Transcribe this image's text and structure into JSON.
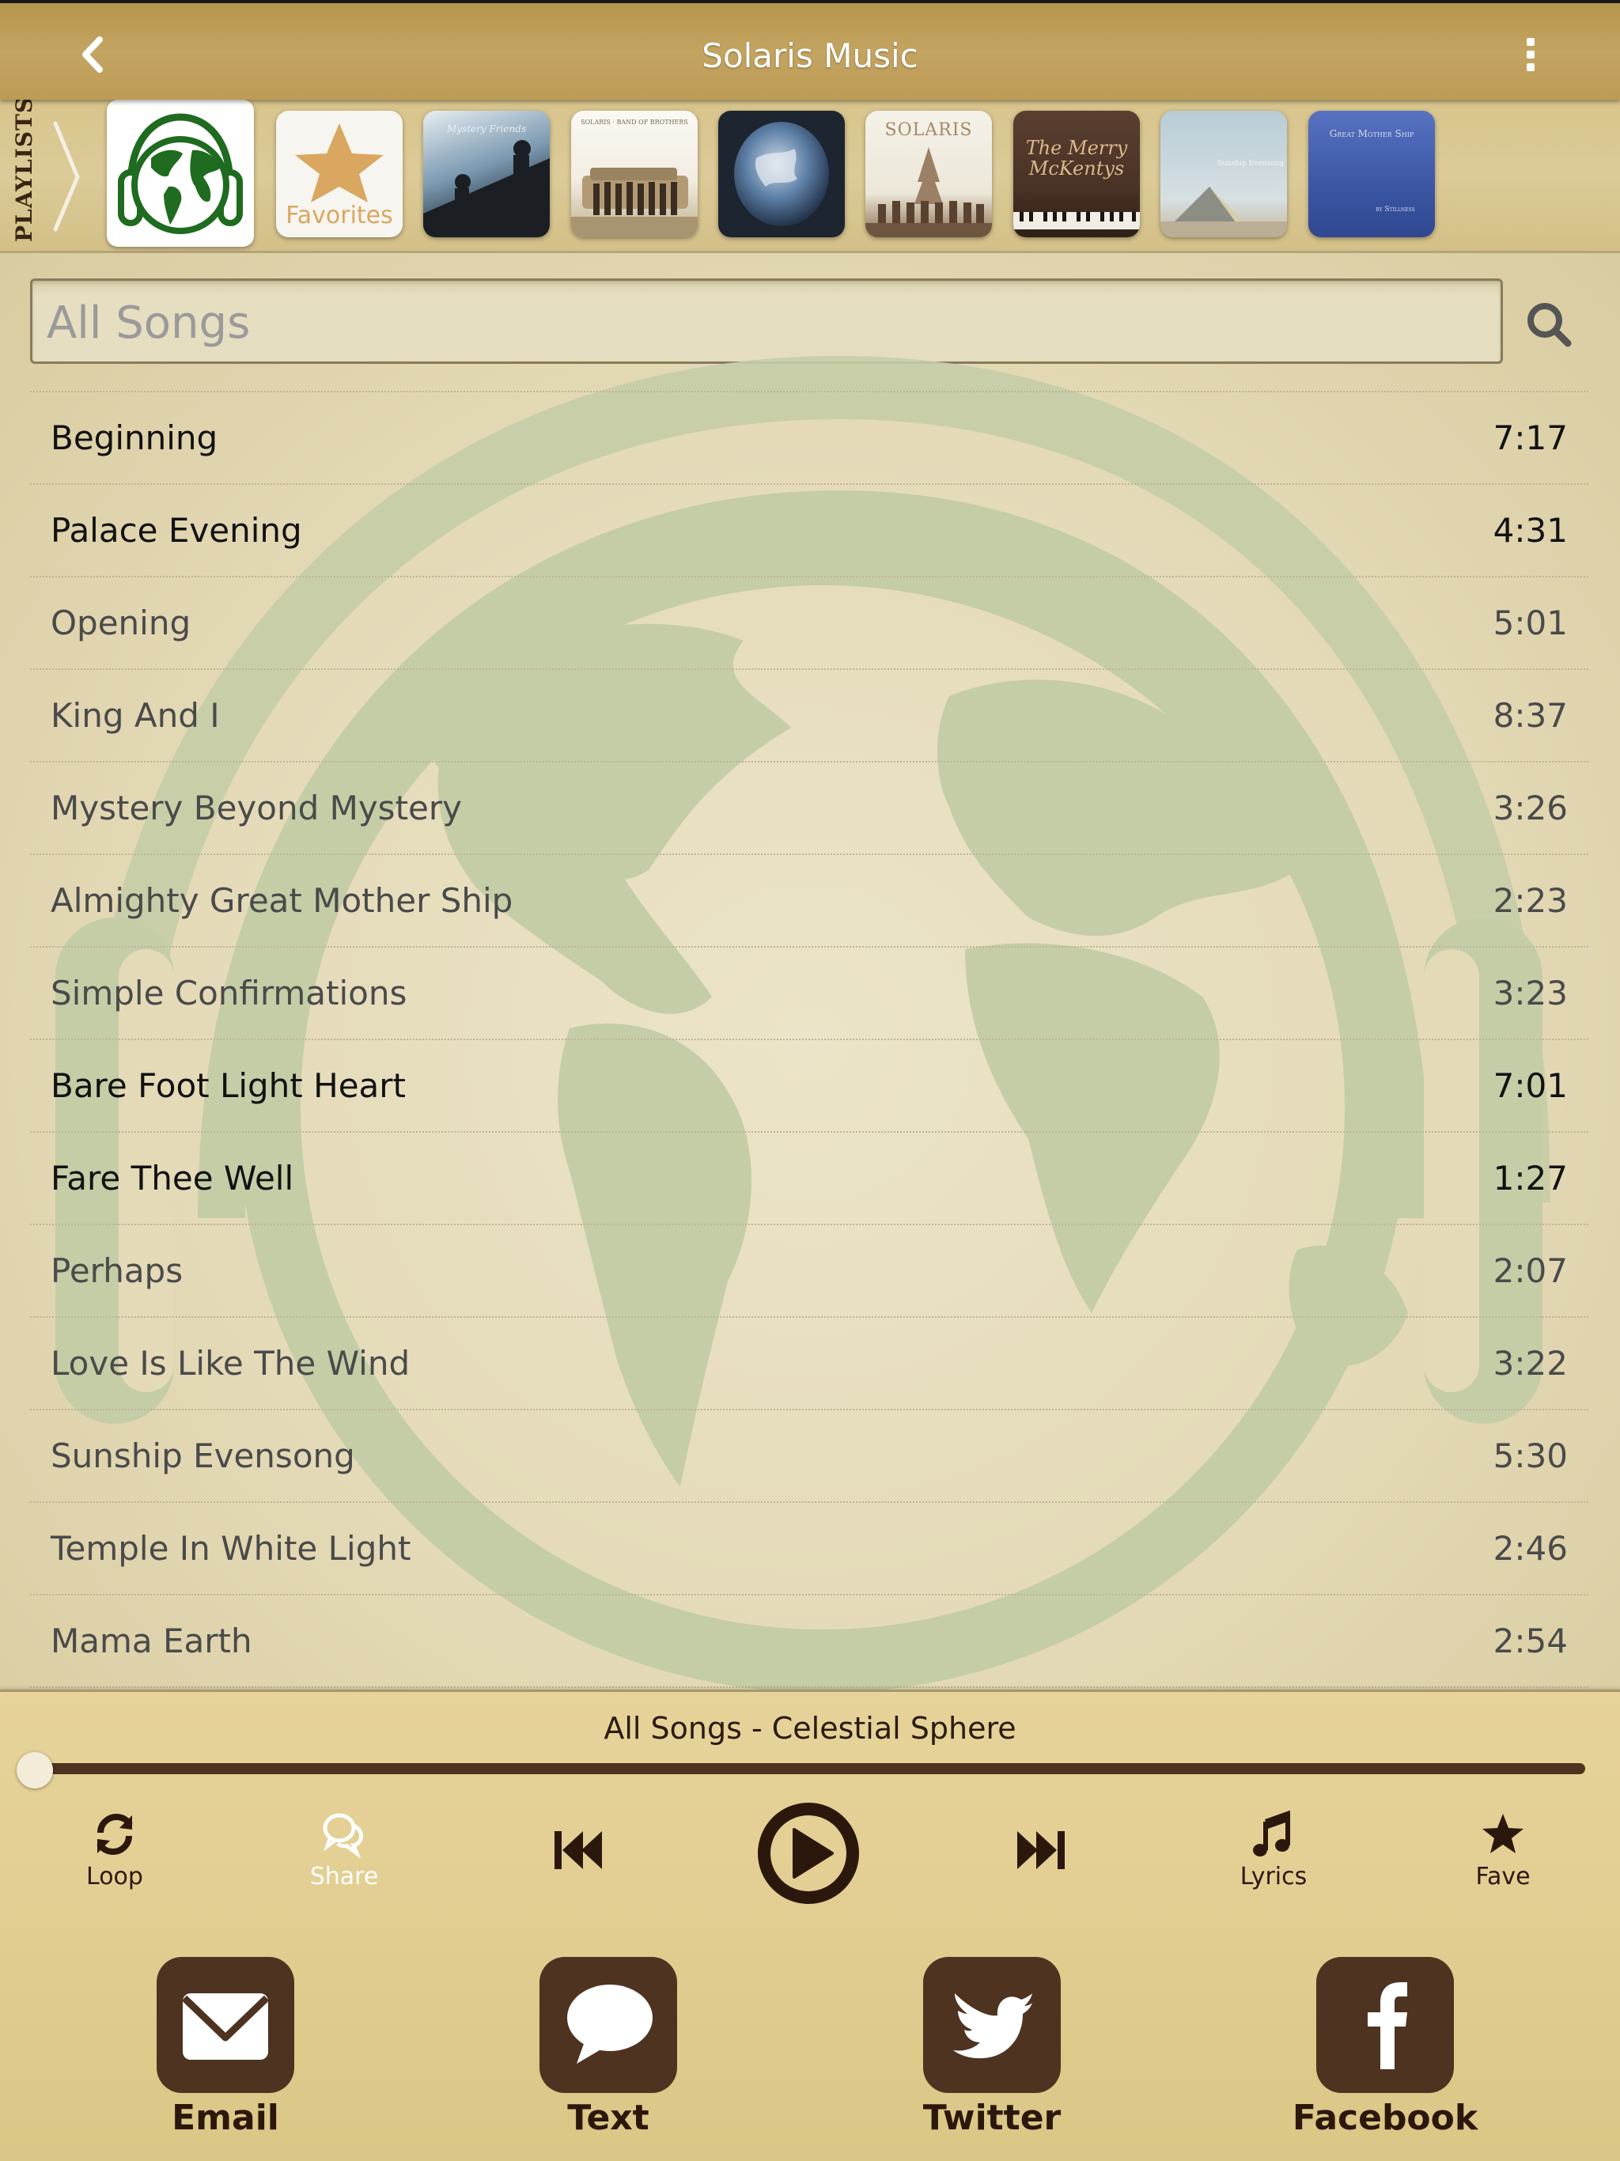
{
  "header": {
    "title": "Solaris Music",
    "back_icon": "chevron-left-icon",
    "menu_icon": "more-vertical-icon"
  },
  "playlists": {
    "label": "PLAYLISTS",
    "items": [
      {
        "name": "All Songs",
        "icon": "globe-headphones-icon",
        "selected": true
      },
      {
        "name": "Favorites",
        "caption": "Favorites",
        "icon": "star-icon"
      },
      {
        "name": "Mystery Friends",
        "caption": "Mystery Friends"
      },
      {
        "name": "Solaris band album",
        "caption": "SOLARIS · BAND OF BROTHERS"
      },
      {
        "name": "Earth album",
        "caption": ""
      },
      {
        "name": "Solaris",
        "caption": "SOLARIS"
      },
      {
        "name": "The Merry McKentys",
        "caption": "The Merry McKentys"
      },
      {
        "name": "Pyramid album",
        "caption": "Sunship Evensong"
      },
      {
        "name": "Great Mother Ship",
        "caption": "Great Mother Ship",
        "subcaption": "by Stillness"
      }
    ]
  },
  "search": {
    "placeholder": "All Songs",
    "value": ""
  },
  "songs": [
    {
      "title": "Beginning",
      "duration": "7:17",
      "active": true
    },
    {
      "title": "Palace Evening",
      "duration": "4:31",
      "active": true
    },
    {
      "title": "Opening",
      "duration": "5:01",
      "active": false
    },
    {
      "title": "King And I",
      "duration": "8:37",
      "active": false
    },
    {
      "title": "Mystery Beyond Mystery",
      "duration": "3:26",
      "active": false
    },
    {
      "title": "Almighty Great Mother Ship",
      "duration": "2:23",
      "active": false
    },
    {
      "title": "Simple Confirmations",
      "duration": "3:23",
      "active": false
    },
    {
      "title": "Bare Foot Light Heart",
      "duration": "7:01",
      "active": true
    },
    {
      "title": "Fare Thee Well",
      "duration": "1:27",
      "active": true
    },
    {
      "title": "Perhaps",
      "duration": "2:07",
      "active": false
    },
    {
      "title": "Love Is Like The Wind",
      "duration": "3:22",
      "active": false
    },
    {
      "title": "Sunship Evensong",
      "duration": "5:30",
      "active": false
    },
    {
      "title": "Temple In White Light",
      "duration": "2:46",
      "active": false
    },
    {
      "title": "Mama Earth",
      "duration": "2:54",
      "active": false
    }
  ],
  "player": {
    "now_playing": "All Songs - Celestial Sphere",
    "progress_fraction": 0.0,
    "controls": {
      "loop": "Loop",
      "share": "Share",
      "lyrics": "Lyrics",
      "fave": "Fave"
    }
  },
  "social": {
    "email": "Email",
    "text": "Text",
    "twitter": "Twitter",
    "facebook": "Facebook"
  },
  "colors": {
    "brown": "#4e3320",
    "dark_text": "#2b170c",
    "accent_green": "#1f6b1f",
    "star_gold": "#d9a760"
  }
}
